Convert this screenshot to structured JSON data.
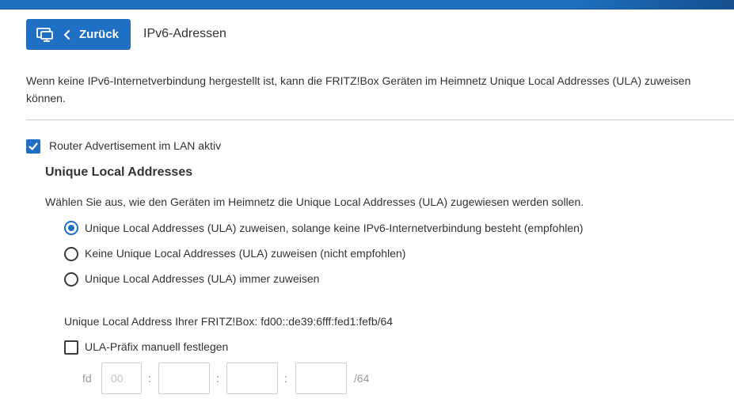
{
  "header": {
    "back_label": "Zurück",
    "page_title": "IPv6-Adressen"
  },
  "intro": {
    "line1": "Wenn keine IPv6-Internetverbindung hergestellt ist, kann die FRITZ!Box Geräten im Heimnetz Unique Local Addresses (ULA) zuweisen",
    "line2": "können."
  },
  "router_advertisement": {
    "label": "Router Advertisement im LAN aktiv",
    "checked": true
  },
  "ula": {
    "heading": "Unique Local Addresses",
    "description": "Wählen Sie aus, wie den Geräten im Heimnetz die Unique Local Addresses (ULA) zugewiesen werden sollen.",
    "options": [
      {
        "label": "Unique Local Addresses (ULA) zuweisen, solange keine IPv6-Internetverbindung besteht (empfohlen)",
        "selected": true
      },
      {
        "label": "Keine Unique Local Addresses (ULA) zuweisen (nicht empfohlen)",
        "selected": false
      },
      {
        "label": "Unique Local Addresses (ULA) immer zuweisen",
        "selected": false
      }
    ],
    "address_info": "Unique Local Address Ihrer FRITZ!Box: fd00::de39:6fff:fed1:fefb/64",
    "manual_prefix": {
      "label": "ULA-Präfix manuell festlegen",
      "checked": false
    },
    "prefix": {
      "lead": "fd",
      "field1_placeholder": "00",
      "field2_value": "",
      "field3_value": "",
      "field4_value": "",
      "separator": ":",
      "suffix": "/64"
    }
  },
  "colors": {
    "accent": "#1f6fc5",
    "top_bar": "#1e6fbf",
    "text": "#333333"
  },
  "icons": {
    "back_button": [
      "monitor-icon",
      "chevron-left-icon"
    ]
  }
}
